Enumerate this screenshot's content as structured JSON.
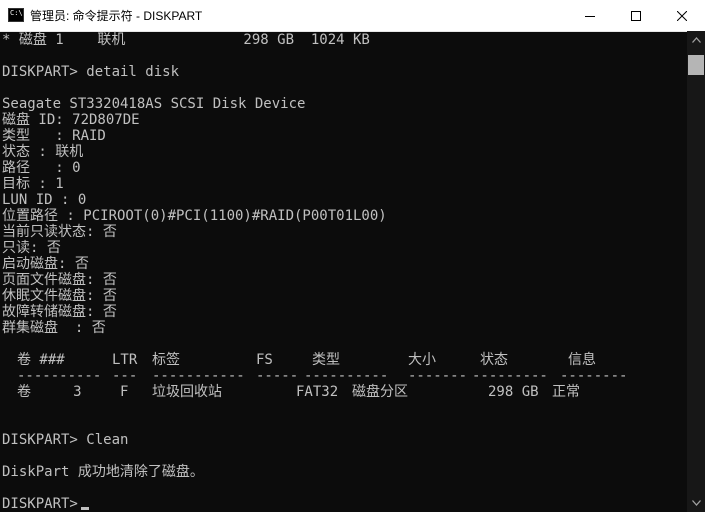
{
  "window": {
    "title": "管理员: 命令提示符 - DISKPART",
    "icon_text": "C:\\."
  },
  "console": {
    "line_disk_list": "* 磁盘 1    联机              298 GB  1024 KB",
    "cmd_detail": "DISKPART> detail disk",
    "disk_model": "Seagate ST3320418AS SCSI Disk Device",
    "disk_id": "磁盘 ID: 72D807DE",
    "type": "类型   : RAID",
    "status": "状态 : 联机",
    "path": "路径   : 0",
    "target": "目标 : 1",
    "lun_id": "LUN ID : 0",
    "location_path": "位置路径 : PCIROOT(0)#PCI(1100)#RAID(P00T01L00)",
    "current_readonly": "当前只读状态: 否",
    "readonly": "只读: 否",
    "boot_disk": "启动磁盘: 否",
    "pagefile_disk": "页面文件磁盘: 否",
    "hibernation_disk": "休眠文件磁盘: 否",
    "crashdump_disk": "故障转储磁盘: 否",
    "cluster_disk": "群集磁盘  : 否",
    "cmd_clean": "DISKPART> Clean",
    "clean_result": "DiskPart 成功地清除了磁盘。",
    "prompt": "DISKPART> "
  },
  "volume_table": {
    "headers": [
      "卷 ###",
      "LTR",
      "标签",
      "FS",
      "类型",
      "大小",
      "状态",
      "信息"
    ],
    "separators": [
      "----------",
      "---",
      "-----------",
      "-----",
      "----------",
      "-------",
      "---------",
      "--------"
    ],
    "rows": [
      [
        "卷     3",
        "F",
        "垃圾回收站",
        "FAT32",
        "磁盘分区",
        "298 GB",
        "正常",
        ""
      ]
    ]
  }
}
